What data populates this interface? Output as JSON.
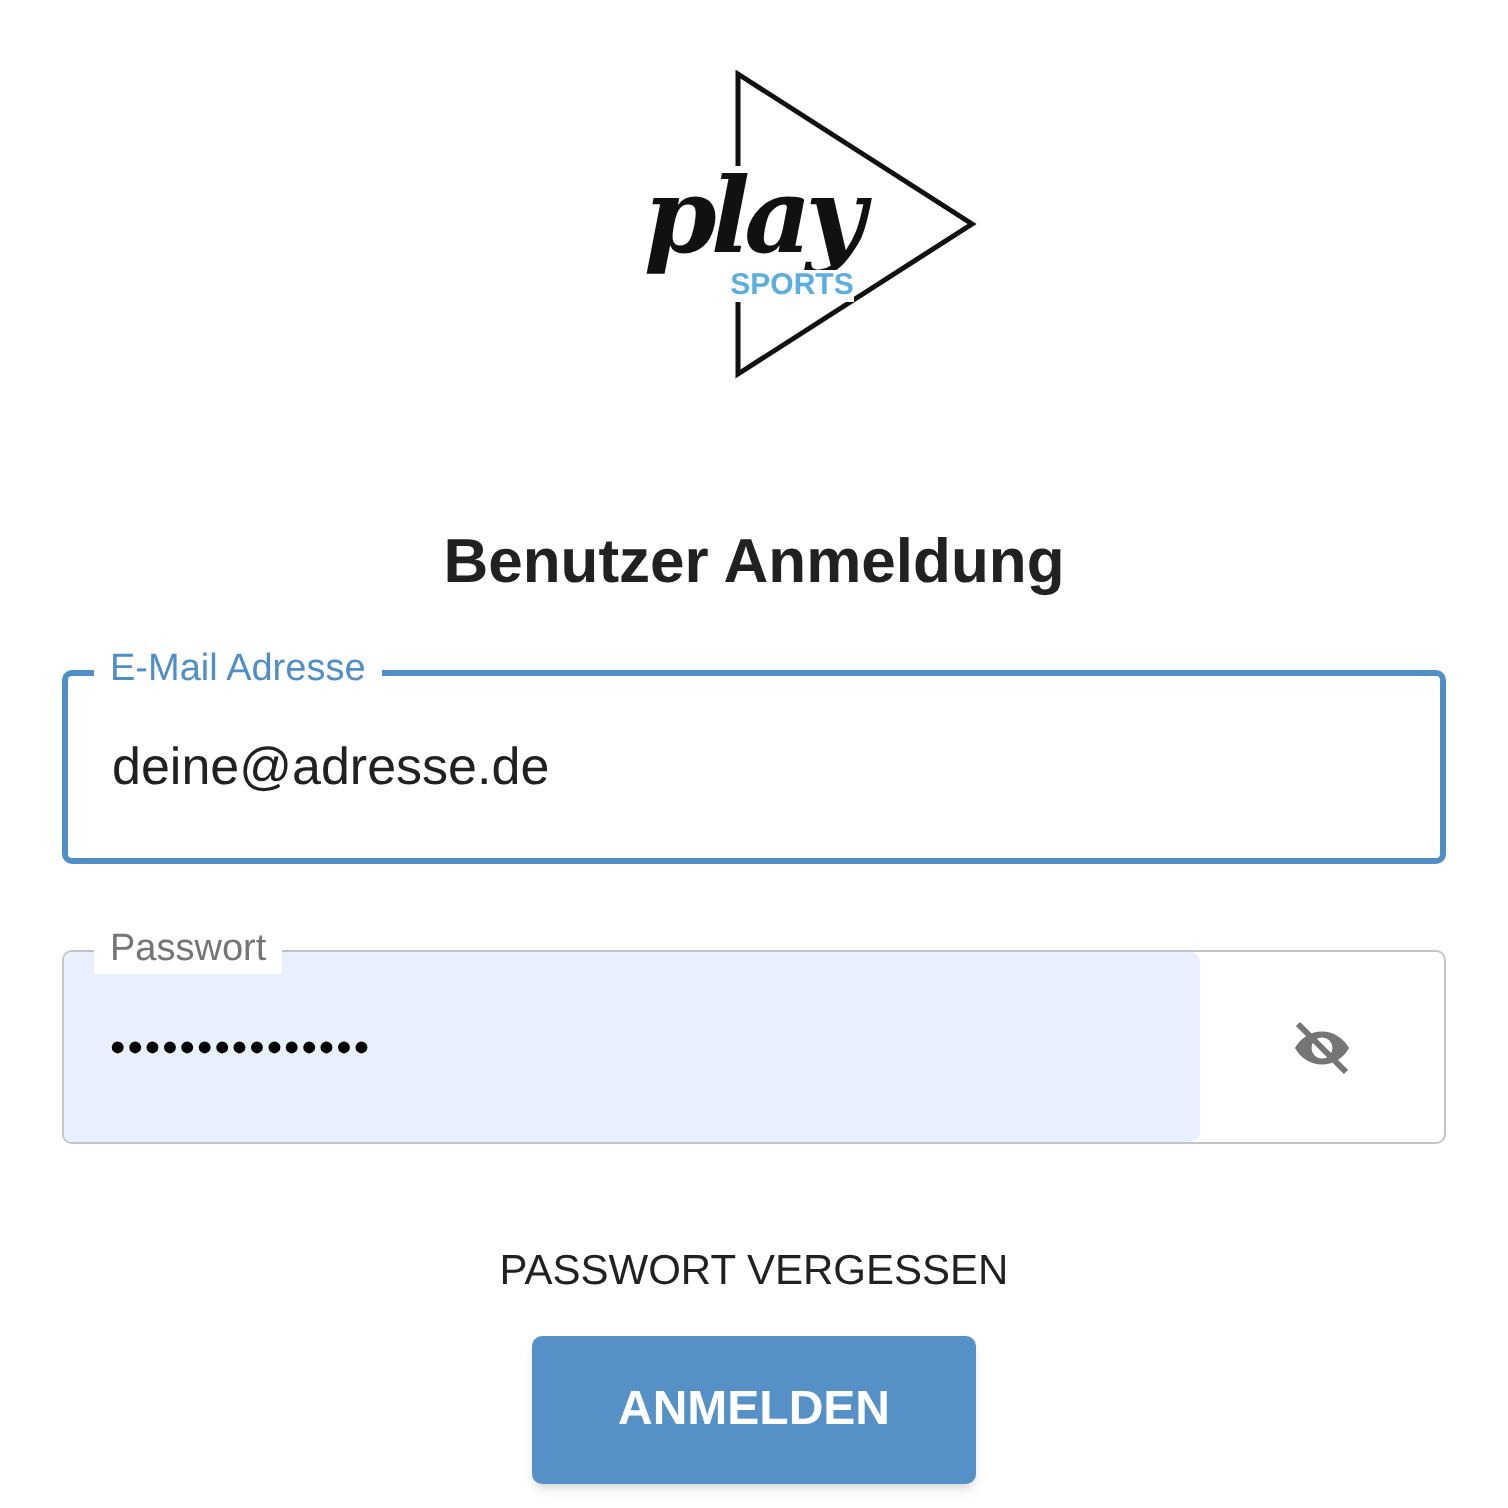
{
  "logo": {
    "wordmark": "play",
    "subtitle": "SPORTS"
  },
  "title": "Benutzer Anmeldung",
  "fields": [
    {
      "label": "E-Mail Adresse",
      "value": "deine@adresse.de",
      "focused": true,
      "kind": "email"
    },
    {
      "label": "Passwort",
      "value": "•••••••••••••••",
      "focused": false,
      "kind": "password"
    }
  ],
  "forgot_link": "PASSWORT VERGESSEN",
  "submit_button": "ANMELDEN"
}
